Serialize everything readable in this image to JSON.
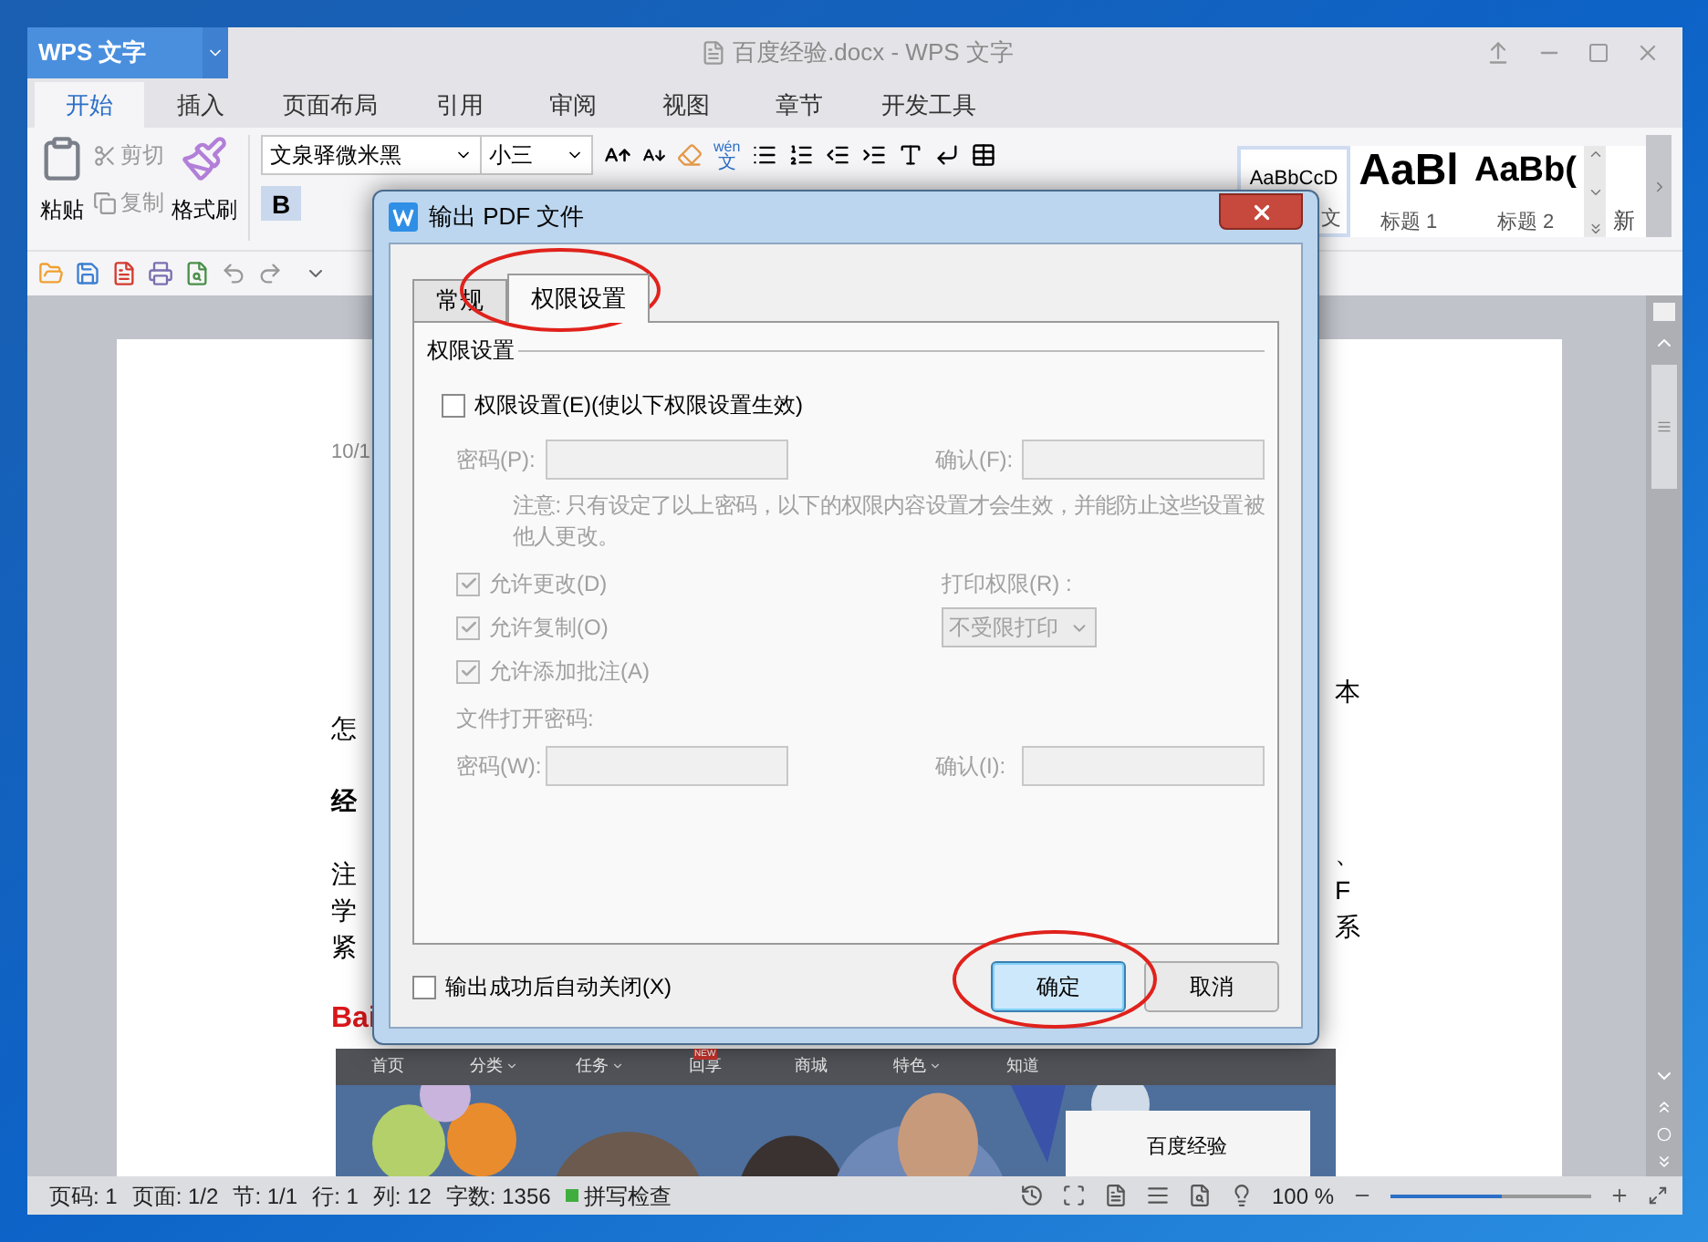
{
  "app_menu": {
    "label": "WPS 文字"
  },
  "window": {
    "title": "百度经验.docx - WPS 文字"
  },
  "tabs": [
    {
      "label": "开始",
      "selected": true
    },
    {
      "label": "插入",
      "selected": false
    },
    {
      "label": "页面布局",
      "selected": false
    },
    {
      "label": "引用",
      "selected": false
    },
    {
      "label": "审阅",
      "selected": false
    },
    {
      "label": "视图",
      "selected": false
    },
    {
      "label": "章节",
      "selected": false
    },
    {
      "label": "开发工具",
      "selected": false
    }
  ],
  "ribbon": {
    "paste": "粘贴",
    "cut": "剪切",
    "copy": "复制",
    "format_painter": "格式刷",
    "font_name": "文泉驿微米黑",
    "font_size": "小三",
    "phonetic_top": "wén",
    "phonetic_bottom": "文",
    "bold": "B",
    "styles": [
      {
        "sample": "AaBbCcD",
        "label": "文",
        "selected": true
      },
      {
        "sample": "AaBl",
        "label": "标题 1",
        "selected": false
      },
      {
        "sample": "AaBb(",
        "label": "标题 2",
        "selected": false
      }
    ],
    "more_styles": "新"
  },
  "document": {
    "header_date": "10/1",
    "left_lines": [
      {
        "text": "怎",
        "kind": "plain"
      },
      {
        "text": "经",
        "kind": "bold"
      },
      {
        "text": "注",
        "kind": "plain"
      },
      {
        "text": "学",
        "kind": "plain"
      },
      {
        "text": "紧",
        "kind": "plain"
      }
    ],
    "right_fragments": [
      "本",
      "、",
      "F",
      "系"
    ],
    "logo_text": "Bai",
    "web_nav": [
      {
        "label": "首页",
        "has_menu": false
      },
      {
        "label": "分类",
        "has_menu": true
      },
      {
        "label": "任务",
        "has_menu": true
      },
      {
        "label": "回享",
        "has_menu": false,
        "badge": "NEW"
      },
      {
        "label": "商城",
        "has_menu": false
      },
      {
        "label": "特色",
        "has_menu": true
      },
      {
        "label": "知道",
        "has_menu": false
      }
    ],
    "web_card": "百度经验"
  },
  "dialog": {
    "title": "输出 PDF 文件",
    "tabs": [
      {
        "label": "常规",
        "selected": false
      },
      {
        "label": "权限设置",
        "selected": true
      }
    ],
    "group_title": "权限设置",
    "enable": {
      "label": "权限设置(E)(使以下权限设置生效)",
      "checked": false
    },
    "disabled": true,
    "password_label": "密码(P):",
    "confirm_label": "确认(F):",
    "note": "注意: 只有设定了以上密码，以下的权限内容设置才会生效，并能防止这些设置被他人更改。",
    "permissions": [
      {
        "label": "允许更改(D)",
        "checked": true
      },
      {
        "label": "允许复制(O)",
        "checked": true
      },
      {
        "label": "允许添加批注(A)",
        "checked": true
      }
    ],
    "print_label": "打印权限(R) :",
    "print_value": "不受限打印",
    "open_password_title": "文件打开密码:",
    "open_password_label": "密码(W):",
    "open_confirm_label": "确认(I):",
    "auto_close": {
      "label": "输出成功后自动关闭(X)",
      "checked": false
    },
    "buttons": [
      {
        "label": "确定",
        "kind": "primary"
      },
      {
        "label": "取消",
        "kind": "default"
      }
    ]
  },
  "status_bar": {
    "items": [
      "页码: 1",
      "页面: 1/2",
      "节: 1/1",
      "行: 1",
      "列: 12",
      "字数: 1356"
    ],
    "spell": "拼写检查",
    "zoom": "100 %",
    "zoom_slider": {
      "level": 0.55
    }
  }
}
